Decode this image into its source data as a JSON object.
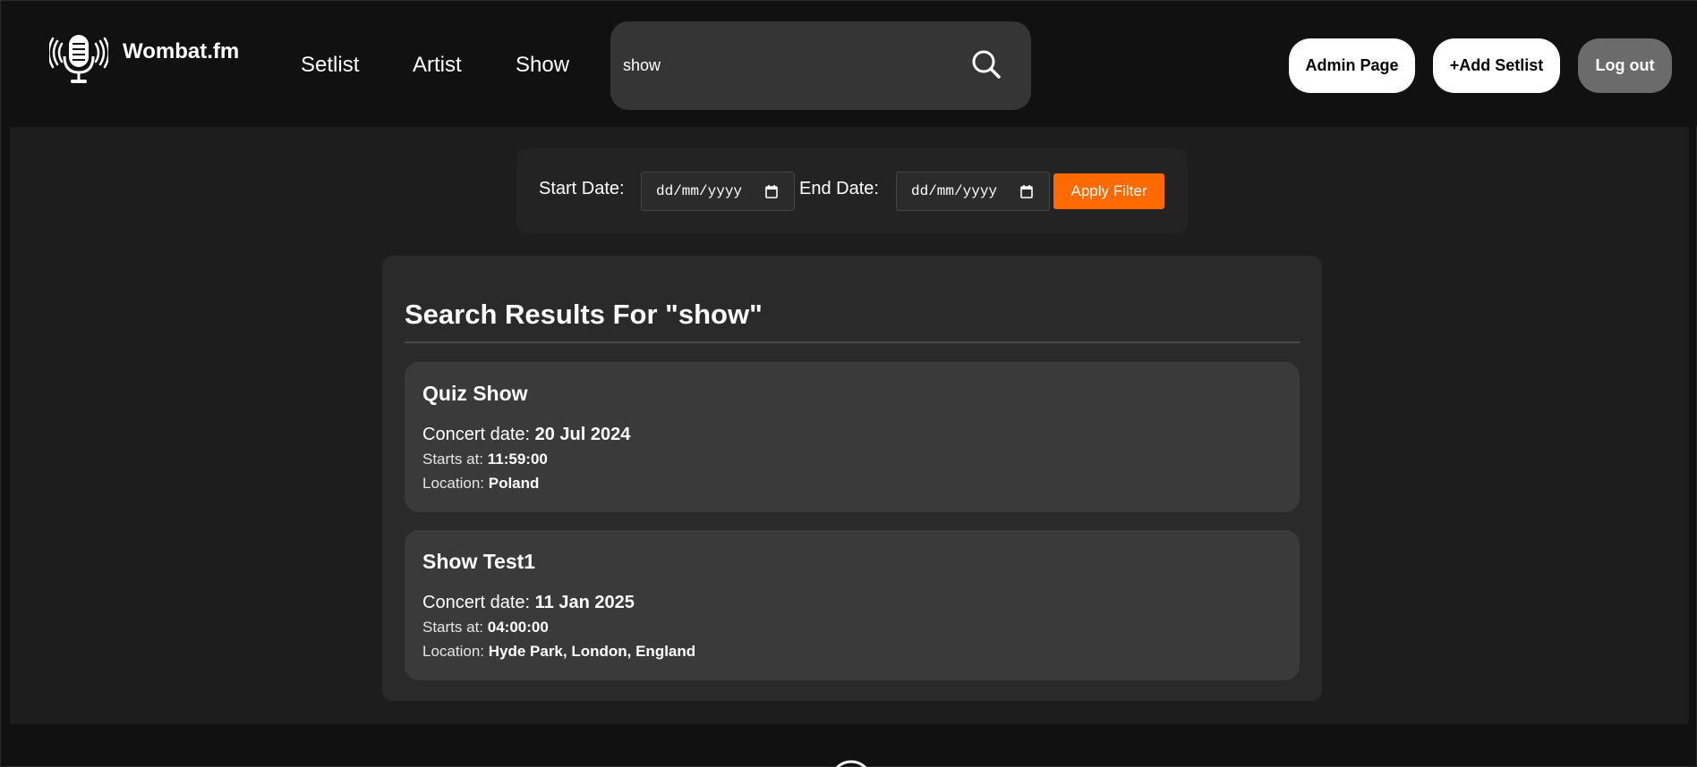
{
  "brand": {
    "name": "Wombat.fm",
    "logo_icon": "microphone-broadcast-icon"
  },
  "nav": {
    "setlist": "Setlist",
    "artist": "Artist",
    "show": "Show"
  },
  "search": {
    "value": "show",
    "icon": "search-icon"
  },
  "header_buttons": {
    "admin": "Admin Page",
    "add_setlist": "+Add Setlist",
    "logout": "Log out"
  },
  "filter": {
    "start_label": "Start Date:",
    "end_label": "End Date:",
    "start_placeholder": "dd/mm/yyyy",
    "end_placeholder": "dd/mm/yyyy",
    "apply_label": "Apply Filter"
  },
  "results": {
    "title": "Search Results For \"show\"",
    "items": [
      {
        "title": "Quiz Show",
        "date_label": "Concert date: ",
        "date": "20 Jul 2024",
        "time_label": "Starts at: ",
        "time": "11:59:00",
        "location_label": "Location: ",
        "location": "Poland"
      },
      {
        "title": "Show Test1",
        "date_label": "Concert date: ",
        "date": "11 Jan 2025",
        "time_label": "Starts at: ",
        "time": "04:00:00",
        "location_label": "Location: ",
        "location": "Hyde Park, London, England"
      }
    ]
  },
  "colors": {
    "background": "#111111",
    "main_panel": "#1d1d1d",
    "card": "#3a3a3a",
    "accent": "#ff6a00",
    "logout_button": "#6b6b6b"
  }
}
